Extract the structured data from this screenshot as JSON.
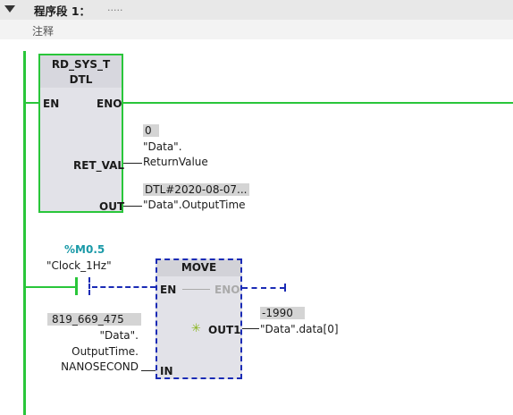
{
  "network": {
    "title": "程序段 1：",
    "dots": ".....",
    "comment": "注释"
  },
  "rd_sys_t": {
    "name": "RD_SYS_T",
    "type": "DTL",
    "en": "EN",
    "eno": "ENO",
    "ret_val_pin": "RET_VAL",
    "out_pin": "OUT",
    "ret_val_value": "0",
    "ret_val_var_1": "\"Data\".",
    "ret_val_var_2": "ReturnValue",
    "out_value": "DTL#2020-08-07...",
    "out_var": "\"Data\".OutputTime"
  },
  "contact": {
    "address": "%M0.5",
    "tag": "\"Clock_1Hz\""
  },
  "move": {
    "name": "MOVE",
    "en": "EN",
    "eno": "ENO",
    "out1_pin": "OUT1",
    "in_pin": "IN",
    "out1_value": "-1990",
    "out1_var": "\"Data\".data[0]",
    "in_value": "819_669_475",
    "in_var_1": "\"Data\".",
    "in_var_2": "OutputTime.",
    "in_var_3": "NANOSECOND",
    "add_icon": "asterisk-add-icon"
  }
}
